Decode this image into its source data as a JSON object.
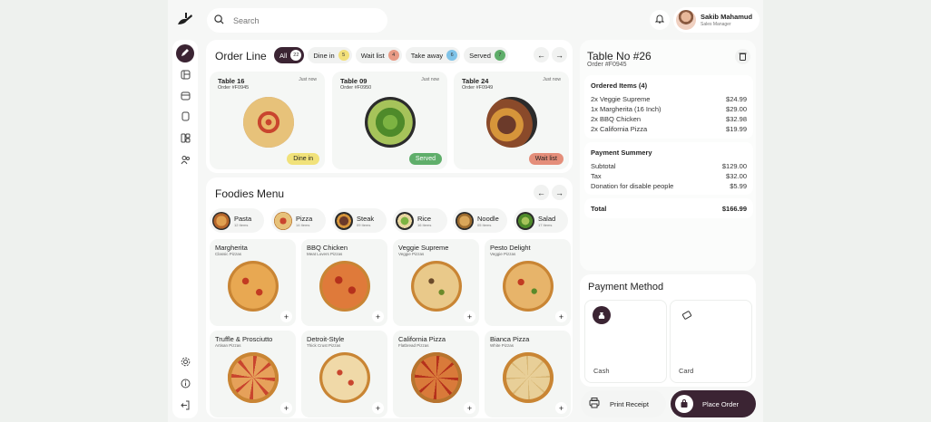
{
  "search": {
    "placeholder": "Search"
  },
  "user": {
    "name": "Sakib Mahamud",
    "role": "Sales Manager"
  },
  "order_line": {
    "title": "Order Line",
    "tabs": [
      {
        "label": "All",
        "count": "22",
        "color": "#ffffff"
      },
      {
        "label": "Dine in",
        "count": "5",
        "color": "#f2e07a"
      },
      {
        "label": "Wait list",
        "count": "4",
        "color": "#e89a85"
      },
      {
        "label": "Take away",
        "count": "6",
        "color": "#7fc3e8"
      },
      {
        "label": "Served",
        "count": "7",
        "color": "#5fae6a"
      }
    ],
    "cards": [
      {
        "table": "Table 16",
        "order": "Order #F0945",
        "time": "Just now",
        "status": "Dine in",
        "status_color": "#f1e27a"
      },
      {
        "table": "Table 09",
        "order": "Order #F0950",
        "time": "Just now",
        "status": "Served",
        "status_color": "#5fae6a"
      },
      {
        "table": "Table 24",
        "order": "Order #F0949",
        "time": "Just now",
        "status": "Wait list",
        "status_color": "#e48e7a"
      }
    ]
  },
  "menu": {
    "title": "Foodies Menu",
    "categories": [
      {
        "name": "Pasta",
        "count": "12 Items"
      },
      {
        "name": "Pizza",
        "count": "14 Items"
      },
      {
        "name": "Steak",
        "count": "09 Items"
      },
      {
        "name": "Rice",
        "count": "16 Items"
      },
      {
        "name": "Noodle",
        "count": "05 Items"
      },
      {
        "name": "Salad",
        "count": "17 Items"
      }
    ],
    "items": [
      {
        "name": "Margherita",
        "sub": "Classic Pizzas"
      },
      {
        "name": "BBQ Chicken",
        "sub": "Meat Lovers Pizzas"
      },
      {
        "name": "Veggie Supreme",
        "sub": "Veggie Pizzas"
      },
      {
        "name": "Pesto Delight",
        "sub": "Veggie Pizzas"
      },
      {
        "name": "Truffle & Prosciutto",
        "sub": "Artisan Pizzas"
      },
      {
        "name": "Detroit-Style",
        "sub": "Thick Crust Pizzas"
      },
      {
        "name": "California Pizza",
        "sub": "Flatbread Pizzas"
      },
      {
        "name": "Bianca Pizza",
        "sub": "White Pizzas"
      }
    ]
  },
  "table": {
    "title": "Table No #26",
    "order": "Order #F0945",
    "ordered_title": "Ordered Items (4)",
    "items": [
      {
        "qty": "2x",
        "name": "Veggie Supreme",
        "price": "$24.99"
      },
      {
        "qty": "1x",
        "name": "Margherita (16 Inch)",
        "price": "$29.00"
      },
      {
        "qty": "2x",
        "name": "BBQ Chicken",
        "price": "$32.98"
      },
      {
        "qty": "2x",
        "name": "California Pizza",
        "price": "$19.99"
      }
    ],
    "summary_title": "Payment Summery",
    "summary": [
      {
        "label": "Subtotal",
        "value": "$129.00"
      },
      {
        "label": "Tax",
        "value": "$32.00"
      },
      {
        "label": "Donation for disable people",
        "value": "$5.99"
      }
    ],
    "total_label": "Total",
    "total_value": "$166.99"
  },
  "payment": {
    "title": "Payment Method",
    "methods": [
      {
        "label": "Cash"
      },
      {
        "label": "Card"
      }
    ],
    "print_label": "Print Receipt",
    "place_label": "Place Order"
  },
  "colors": {
    "accent": "#3b2433",
    "bg": "#eef1ee"
  }
}
